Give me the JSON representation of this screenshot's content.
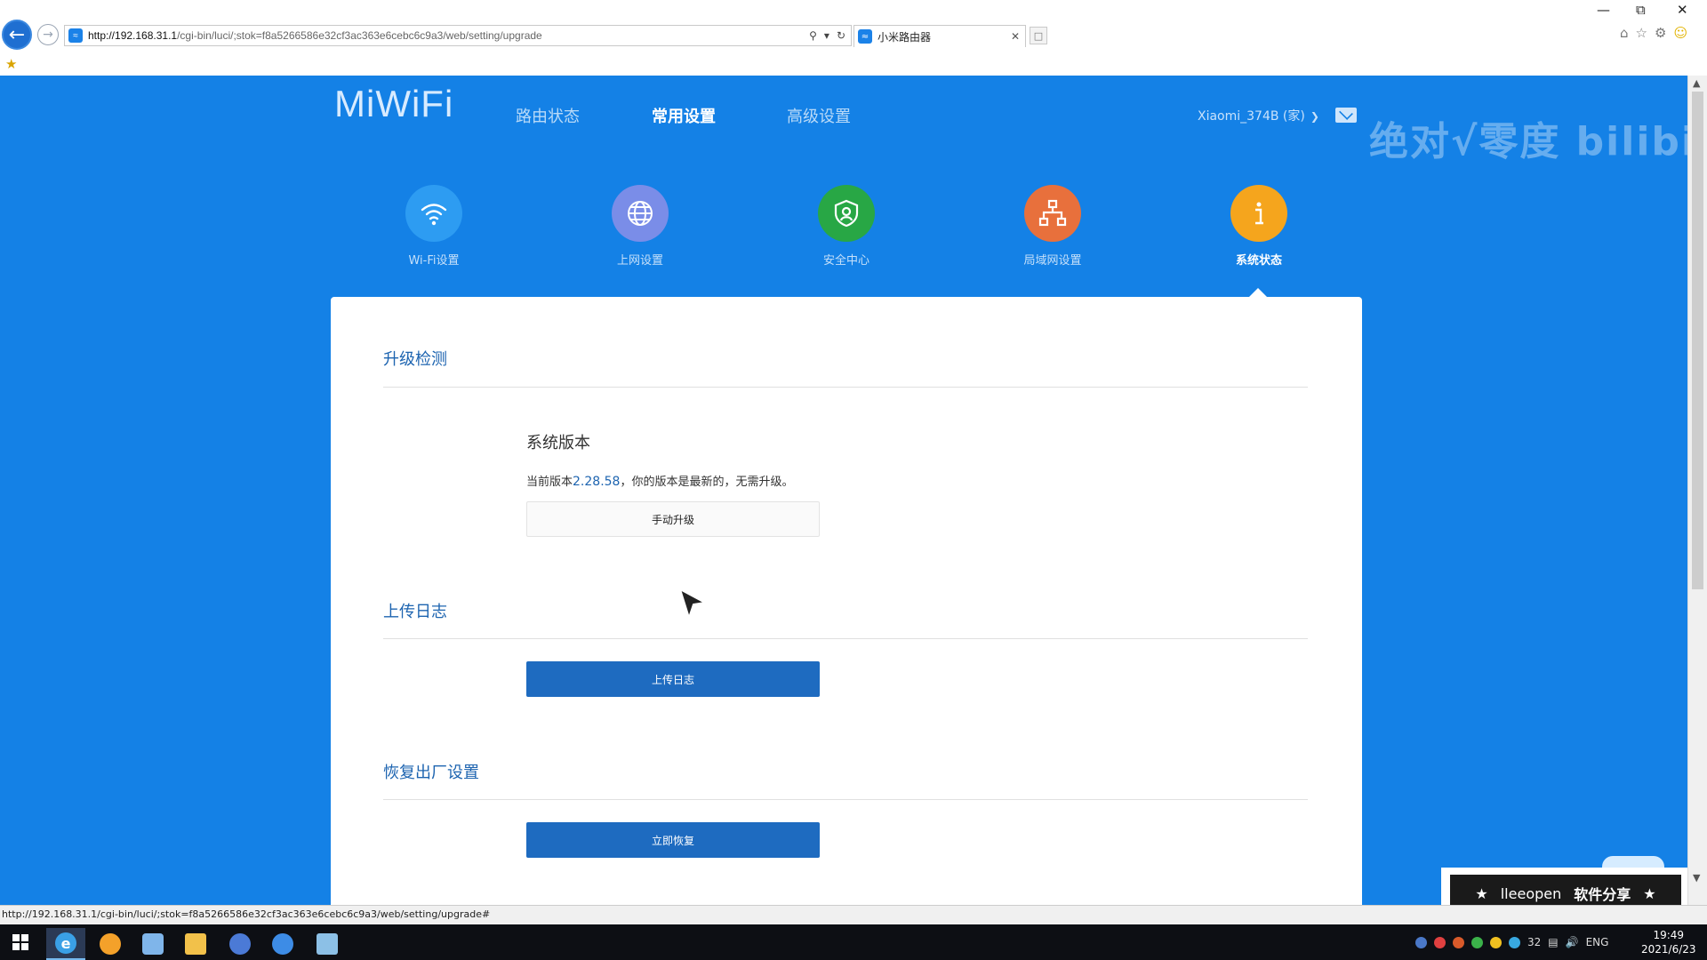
{
  "browser": {
    "url_host": "http://192.168.31.1",
    "url_path": "/cgi-bin/luci/;stok=f8a5266586e32cf3ac363e6cebc6c9a3/web/setting/upgrade",
    "tab_title": "小米路由器",
    "status_url": "http://192.168.31.1/cgi-bin/luci/;stok=f8a5266586e32cf3ac363e6cebc6c9a3/web/setting/upgrade#"
  },
  "router": {
    "logo": "MiWiFi",
    "nav": [
      "路由状态",
      "常用设置",
      "高级设置"
    ],
    "router_name": "Xiaomi_374B (家)",
    "categories": [
      {
        "label": "Wi-Fi设置"
      },
      {
        "label": "上网设置"
      },
      {
        "label": "安全中心"
      },
      {
        "label": "局域网设置"
      },
      {
        "label": "系统状态"
      }
    ]
  },
  "upgrade": {
    "section_title": "升级检测",
    "sysver_title": "系统版本",
    "current_prefix": "当前版本",
    "version": "2.28.58",
    "current_suffix": "，你的版本是最新的，无需升级。",
    "manual_button": "手动升级"
  },
  "log": {
    "section_title": "上传日志",
    "button": "上传日志"
  },
  "reset": {
    "section_title": "恢复出厂设置",
    "button": "立即恢复"
  },
  "overlay": {
    "watermark": "绝对√零度 bilibili",
    "banner_name": "lleeopen",
    "banner_text": "软件分享"
  },
  "taskbar": {
    "lang": "ENG",
    "tray_count": "32",
    "time": "19:49",
    "date": "2021/6/23"
  },
  "colors": {
    "page_bg": "#1481e6",
    "primary_button": "#1e6bc0",
    "wifi": "#2d9cf2",
    "net": "#7a8de8",
    "security": "#28a745",
    "lan": "#e8703c",
    "system": "#f5a51d"
  },
  "icons": {
    "categories": [
      "wifi-icon",
      "globe-icon",
      "shield-icon",
      "network-icon",
      "info-icon"
    ]
  }
}
